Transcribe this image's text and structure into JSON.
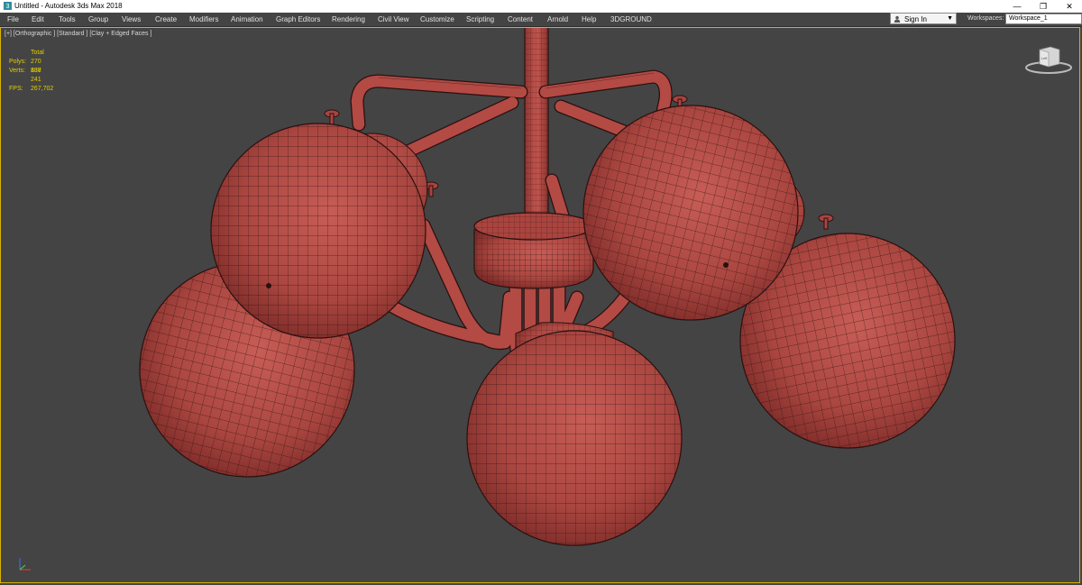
{
  "window": {
    "title": "Untitled - Autodesk 3ds Max 2018",
    "minimize_glyph": "—",
    "restore_glyph": "❐",
    "close_glyph": "✕"
  },
  "menu": {
    "items": [
      "File",
      "Edit",
      "Tools",
      "Group",
      "Views",
      "Create",
      "Modifiers",
      "Animation",
      "Graph Editors",
      "Rendering",
      "Civil View",
      "Customize",
      "Scripting",
      "Content",
      "Arnold",
      "Help",
      "3DGROUND"
    ]
  },
  "account": {
    "signin_label": "Sign In",
    "caret": "▼"
  },
  "workspaces": {
    "label": "Workspaces:",
    "value": "Workspace_1"
  },
  "viewport": {
    "label": "[+] [Orthographic ] [Standard ] [Clay + Edged Faces ]",
    "stats": {
      "total_label": "Total",
      "polys_label": "Polys:",
      "polys": "270 888",
      "verts_label": "Verts:",
      "verts": "137 241",
      "fps_label": "FPS:",
      "fps": "267,702"
    },
    "viewcube_face": "Left"
  },
  "colors": {
    "viewport_bg": "#444444",
    "clay": "#b34a44",
    "active_viewport_border": "#d8b400",
    "stats_text": "#e3d000"
  },
  "icons": {
    "app": "3dsmax-app-icon",
    "user": "user-icon",
    "viewcube": "viewcube-icon",
    "axis": "axis-tripod-icon"
  }
}
